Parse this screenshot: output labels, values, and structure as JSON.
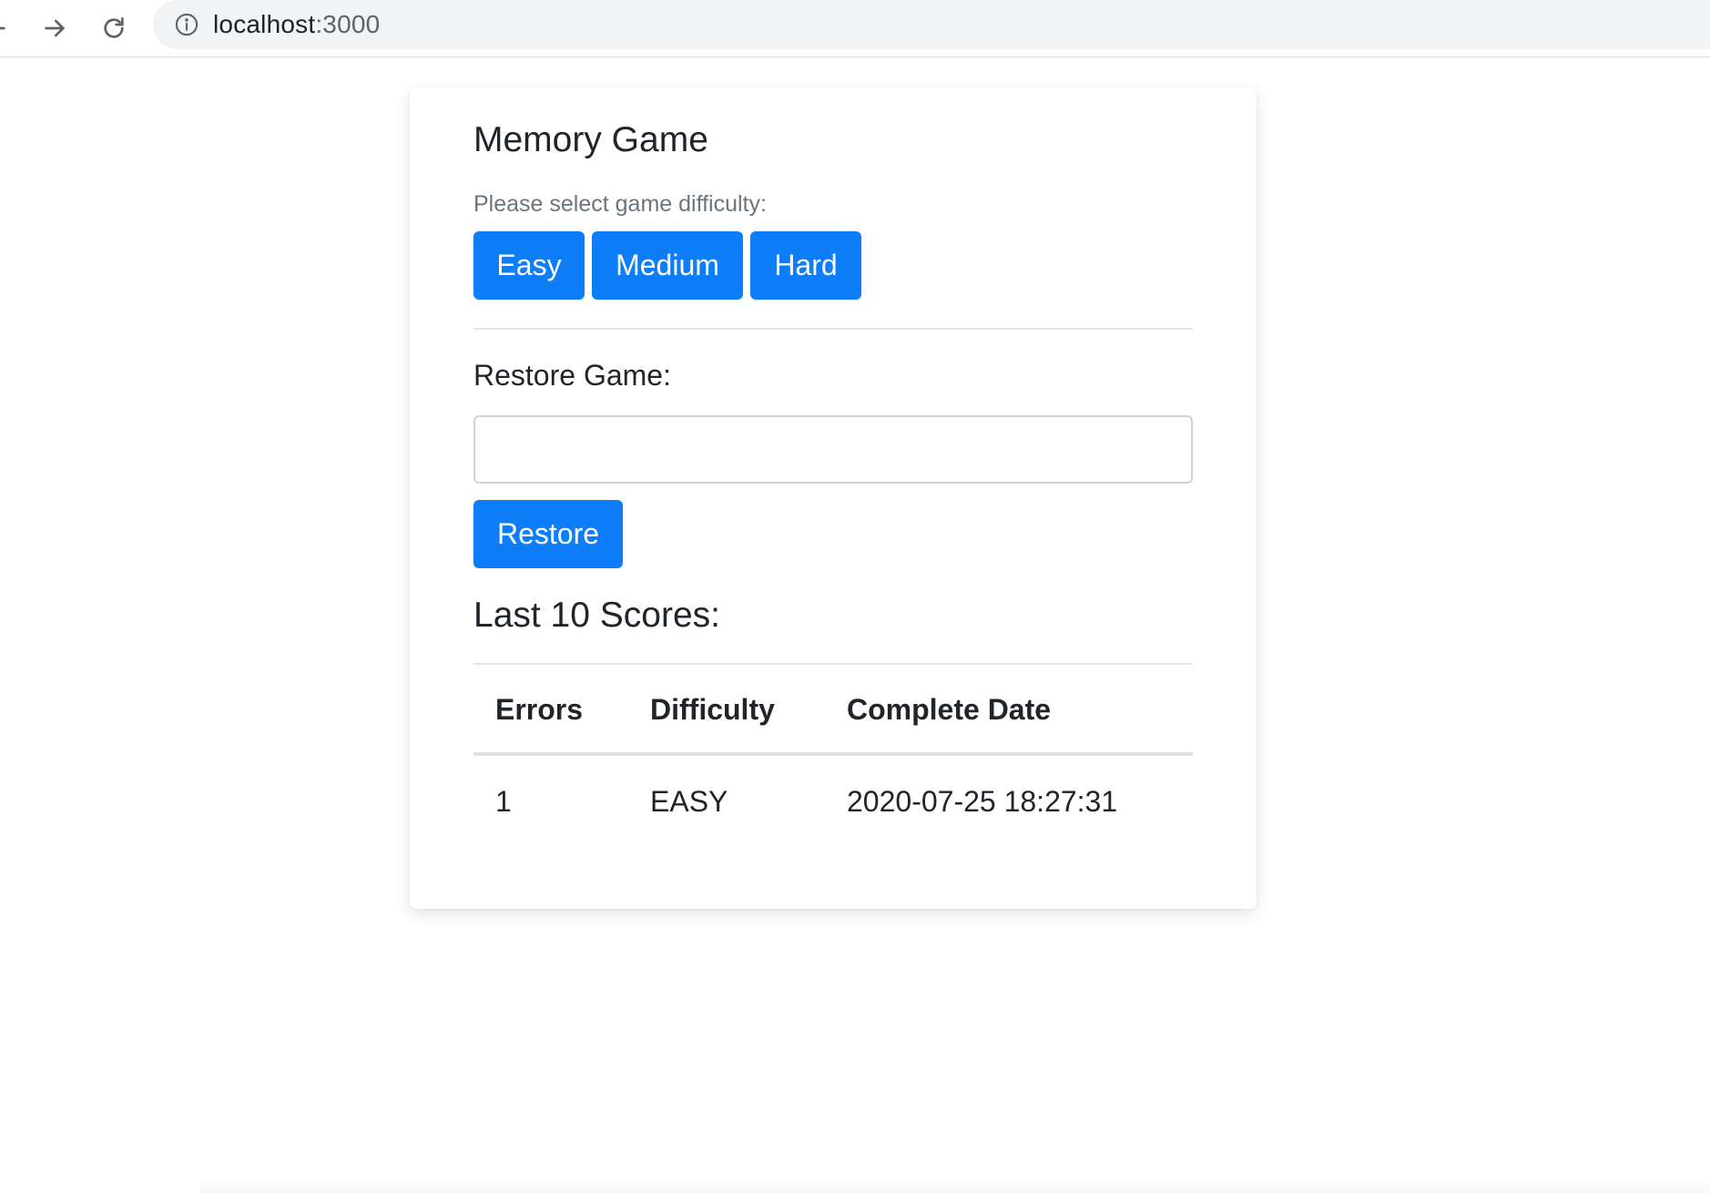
{
  "browser": {
    "url_host": "localhost",
    "url_port": ":3000",
    "icons": [
      "back-arrow-icon",
      "forward-arrow-icon",
      "reload-icon",
      "info-icon"
    ]
  },
  "game": {
    "title": "Memory Game",
    "difficulty_prompt": "Please select game difficulty:",
    "difficulty_buttons": [
      "Easy",
      "Medium",
      "Hard"
    ],
    "restore_label": "Restore Game:",
    "restore_input_value": "",
    "restore_button": "Restore",
    "scores_title": "Last 10 Scores:"
  },
  "scores_table": {
    "headers": [
      "Errors",
      "Difficulty",
      "Complete Date"
    ],
    "rows": [
      [
        "1",
        "EASY",
        "2020-07-25 18:27:31"
      ]
    ]
  },
  "colors": {
    "primary_button": "#0d7ef7",
    "muted_text": "#6c757d",
    "text": "#212529"
  }
}
